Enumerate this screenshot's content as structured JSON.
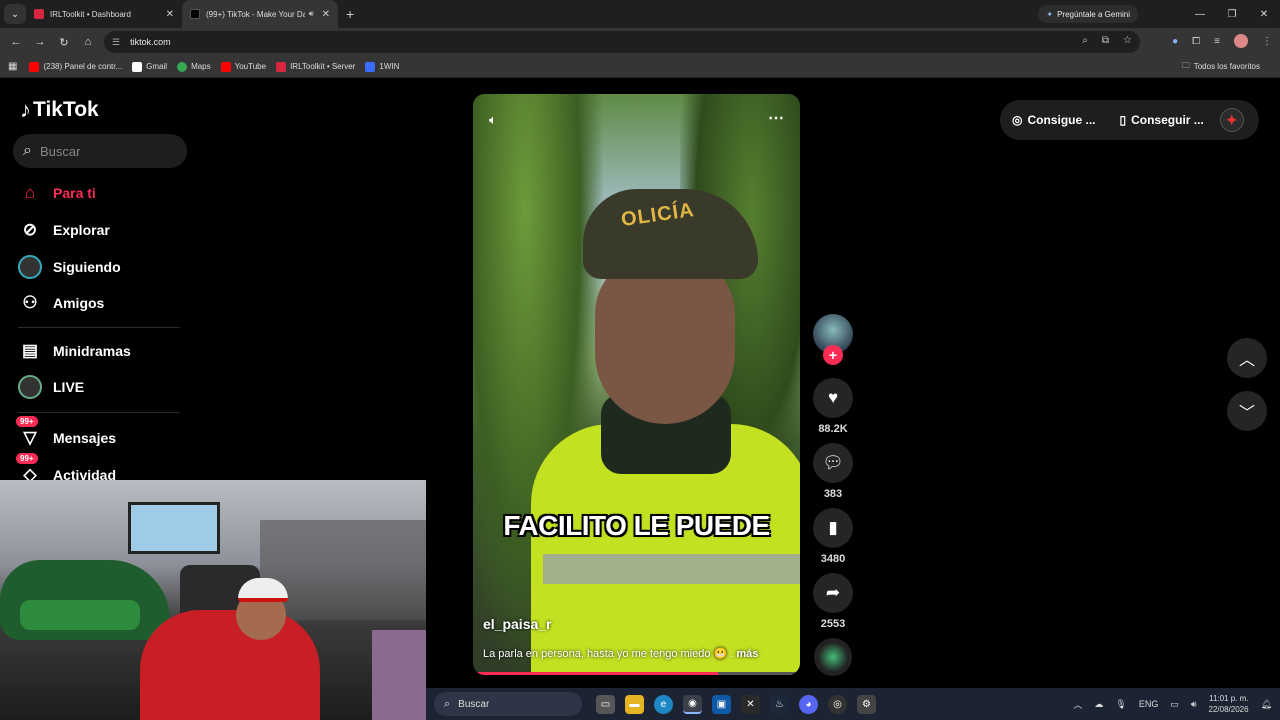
{
  "browser": {
    "tabs": [
      {
        "title": "IRLToolkit • Dashboard",
        "favicon_color": "#d7263d",
        "active": false
      },
      {
        "title": "(99+) TikTok - Make Your Da",
        "favicon_color": "#000000",
        "active": true
      }
    ],
    "new_tab_label": "+",
    "gemini_label": "Pregúntale a Gemini",
    "url": "tiktok.com",
    "bookmarks": [
      {
        "label": "(238) Panel de contr...",
        "color": "#ff0000"
      },
      {
        "label": "Gmail",
        "color": "#ffffff"
      },
      {
        "label": "Maps",
        "color": "#34a853"
      },
      {
        "label": "YouTube",
        "color": "#ff0000"
      },
      {
        "label": "IRLToolkit • Server",
        "color": "#d7263d"
      },
      {
        "label": "1WIN",
        "color": "#3b6cff"
      }
    ],
    "all_bookmarks_label": "Todos los favoritos"
  },
  "tiktok": {
    "logo": "TikTok",
    "search_placeholder": "Buscar",
    "nav": [
      {
        "label": "Para ti",
        "icon": "home-icon",
        "active": true
      },
      {
        "label": "Explorar",
        "icon": "compass-icon",
        "active": false
      },
      {
        "label": "Siguiendo",
        "icon": "following-avatar-icon",
        "active": false
      },
      {
        "label": "Amigos",
        "icon": "friends-icon",
        "active": false
      },
      {
        "label": "Minidramas",
        "icon": "film-icon",
        "active": false
      },
      {
        "label": "LIVE",
        "icon": "live-icon",
        "active": false
      },
      {
        "label": "Mensajes",
        "icon": "message-icon",
        "badge": "99+"
      },
      {
        "label": "Actividad",
        "icon": "activity-icon",
        "badge": "99+"
      }
    ],
    "video": {
      "cap_text": "OLICÍA",
      "caption_overlay": "FACILITO LE PUEDE",
      "author": "el_paisa_r",
      "description": "La parla en persona, hasta yo me tengo miedo 😬 .",
      "more_label": "más",
      "progress": 0.75
    },
    "actions": {
      "likes": "88.2K",
      "comments": "383",
      "saves": "3480",
      "shares": "2553"
    },
    "top_right": {
      "coins_label": "Consigue ...",
      "app_label": "Conseguir ..."
    }
  },
  "taskbar": {
    "search_label": "Buscar",
    "lang": "ENG",
    "time": "11:01 p. m.",
    "date": "22/08/2026"
  },
  "colors": {
    "accent": "#fe2c55",
    "background": "#000000"
  }
}
